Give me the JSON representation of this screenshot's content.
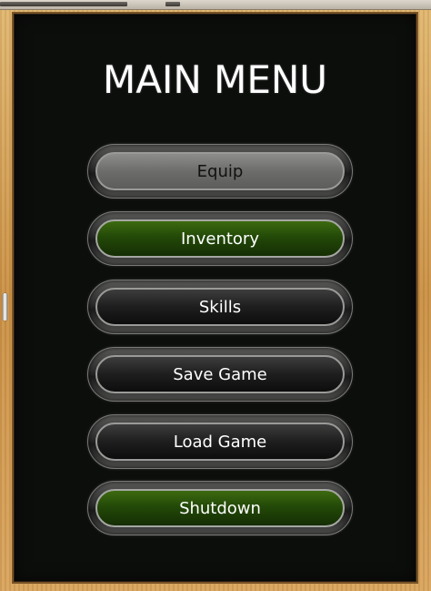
{
  "menu": {
    "title": "MAIN MENU",
    "buttons": [
      {
        "label": "Equip",
        "style": "gray"
      },
      {
        "label": "Inventory",
        "style": "green"
      },
      {
        "label": "Skills",
        "style": "dark"
      },
      {
        "label": "Save Game",
        "style": "dark"
      },
      {
        "label": "Load Game",
        "style": "dark"
      },
      {
        "label": "Shutdown",
        "style": "green"
      }
    ]
  },
  "colors": {
    "board": "#0c0e0c",
    "frame": "#c98f45",
    "green_button": "#234908",
    "gray_button": "#6c6d6b",
    "dark_button": "#1d1e1d",
    "text": "#ffffff"
  }
}
